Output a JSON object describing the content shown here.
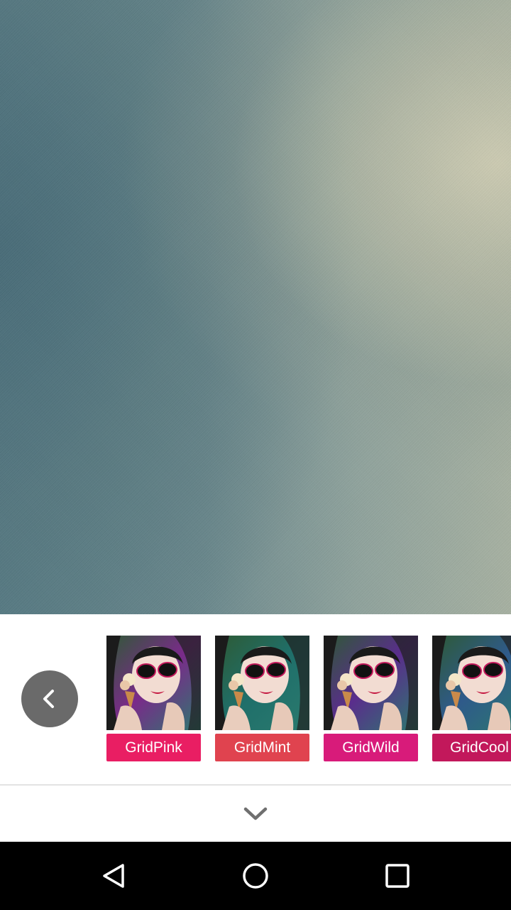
{
  "preview": {
    "icon": "camera-preview"
  },
  "filter_panel": {
    "back_icon": "chevron-left-icon",
    "filters": [
      {
        "label": "GridPink",
        "color": "#e91e63",
        "tint": "#7a2a8a"
      },
      {
        "label": "GridMint",
        "color": "#e0434f",
        "tint": "#1f6f6a"
      },
      {
        "label": "GridWild",
        "color": "#d81b7a",
        "tint": "#5a2d8c"
      },
      {
        "label": "GridCool",
        "color": "#c2185b",
        "tint": "#2f5a8a"
      }
    ],
    "collapse_icon": "chevron-down-icon"
  },
  "nav_bar": {
    "back_icon": "triangle-back-icon",
    "home_icon": "circle-home-icon",
    "recents_icon": "square-recents-icon"
  },
  "colors": {
    "accent_pink": "#e91e63",
    "nav_background": "#000000",
    "back_button_bg": "#6a6a6a"
  }
}
